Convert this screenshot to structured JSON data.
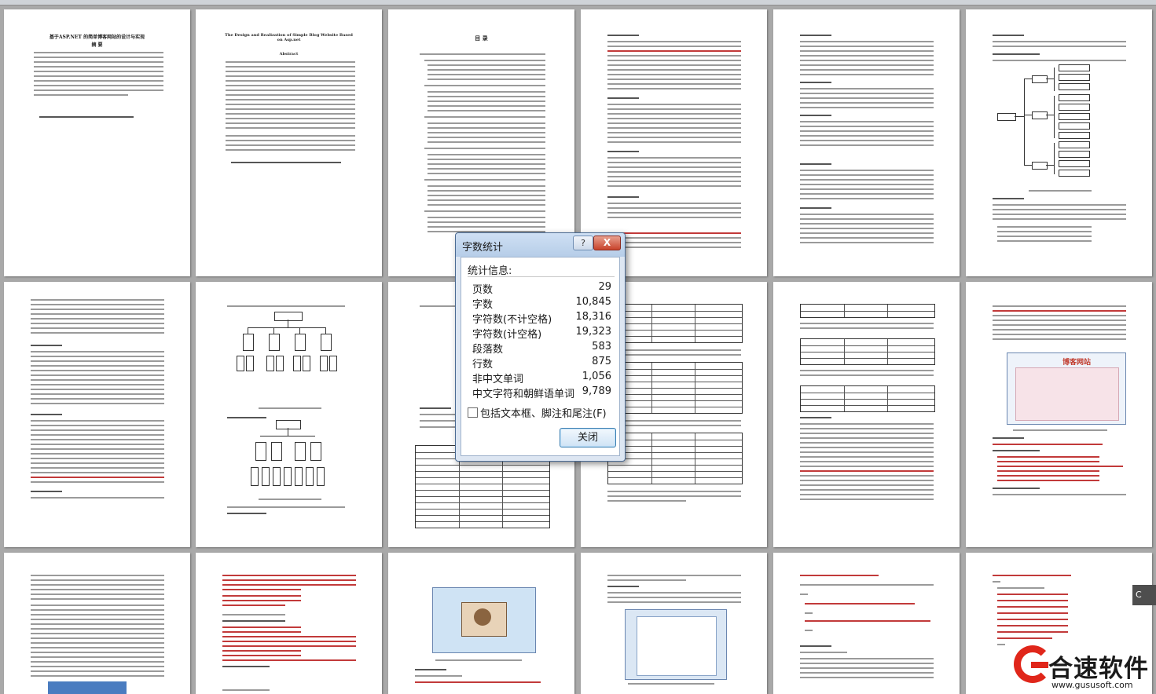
{
  "dialog": {
    "title": "字数统计",
    "help_icon": "question-icon",
    "close_icon": "close-x-icon",
    "close_glyph": "X",
    "help_glyph": "?",
    "section_label": "统计信息:",
    "stats": [
      {
        "label": "页数",
        "value": "29"
      },
      {
        "label": "字数",
        "value": "10,845"
      },
      {
        "label": "字符数(不计空格)",
        "value": "18,316"
      },
      {
        "label": "字符数(计空格)",
        "value": "19,323"
      },
      {
        "label": "段落数",
        "value": "583"
      },
      {
        "label": "行数",
        "value": "875"
      },
      {
        "label": "非中文单词",
        "value": "1,056"
      },
      {
        "label": "中文字符和朝鲜语单词",
        "value": "9,789"
      }
    ],
    "checkbox_label": "包括文本框、脚注和尾注(F)",
    "checkbox_checked": false,
    "close_button": "关闭"
  },
  "pages": {
    "p1_title": "基于ASP.NET 的简单博客网站的设计与实现",
    "p1_subtitle": "摘 要",
    "p2_title": "The Design and Realization of Simple Blog Website Based on Asp.net",
    "p2_subtitle": "Abstract",
    "p3_title": "目 录",
    "blog_banner": "博客网站"
  },
  "watermark": {
    "name": "合速软件",
    "url": "www.gususoft.com",
    "accent": "#e0261a"
  },
  "side_tab": "C"
}
